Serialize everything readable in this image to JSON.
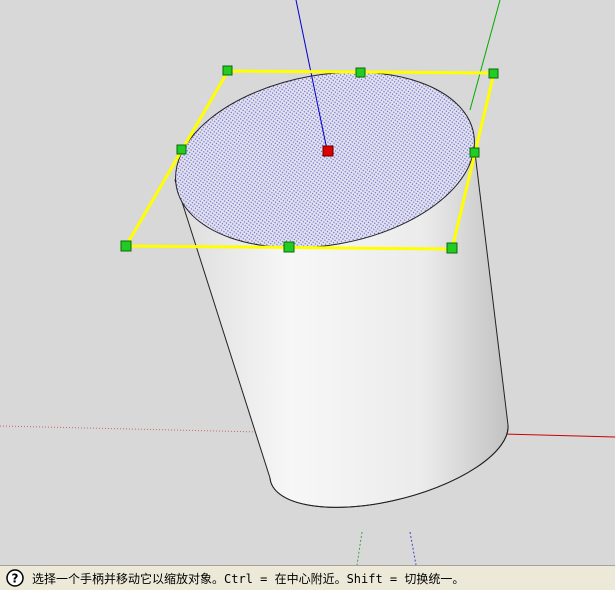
{
  "status_bar": {
    "help_icon": "question-mark-circle-icon",
    "message": "选择一个手柄并移动它以缩放对象。Ctrl = 在中心附近。Shift = 切换统一。"
  },
  "scene": {
    "object": "cylinder",
    "tool": "scale",
    "colors": {
      "background": "#d8d8d8",
      "selection_box": "#ffff00",
      "grip": "#22cc22",
      "center_grip": "#dd0000",
      "axis_blue": "#0000cc",
      "axis_green": "#00aa00",
      "axis_red": "#cc0000",
      "face_fill": "#e4e4ee",
      "face_dots": "#6a6ad0"
    }
  }
}
